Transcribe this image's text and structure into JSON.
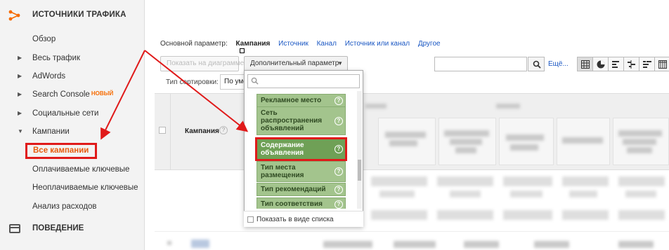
{
  "sidebar": {
    "title": "ИСТОЧНИКИ ТРАФИКА",
    "items": [
      {
        "label": "Обзор",
        "arrow": ""
      },
      {
        "label": "Весь трафик",
        "arrow": "▶"
      },
      {
        "label": "AdWords",
        "arrow": "▶"
      },
      {
        "label": "Search Console",
        "arrow": "▶",
        "badge": "НОВЫЙ"
      },
      {
        "label": "Социальные сети",
        "arrow": "▶"
      },
      {
        "label": "Кампании",
        "arrow": "▼"
      },
      {
        "label": "Все кампании",
        "arrow": "",
        "active": true
      },
      {
        "label": "Оплачиваемые ключевые",
        "arrow": ""
      },
      {
        "label": "Неоплачиваемые ключевые",
        "arrow": ""
      },
      {
        "label": "Анализ расходов",
        "arrow": ""
      }
    ],
    "behavior_label": "ПОВЕДЕНИЕ"
  },
  "primary": {
    "label": "Основной параметр:",
    "active": "Кампания",
    "links": [
      "Источник",
      "Канал",
      "Источник или канал",
      "Другое"
    ]
  },
  "toolbar": {
    "chart_button": "Показать на диаграмме",
    "secondary_button": "Дополнительный параметр",
    "sort_label": "Тип сортировки:",
    "sort_value": "По умолчанию",
    "search_value": "",
    "more_link": "Ещё...",
    "view_icons": [
      "table-view-icon",
      "pie-view-icon",
      "performance-view-icon",
      "comparison-view-icon",
      "term-cloud-view-icon",
      "pivot-view-icon"
    ]
  },
  "table": {
    "campaign_header": "Кампания",
    "help_glyph": "?"
  },
  "dropdown": {
    "search_placeholder": "",
    "options": [
      {
        "label": "Рекламное место"
      },
      {
        "label": "Сеть распространения объявлений"
      },
      {
        "label": "Содержание объявления",
        "selected": true
      },
      {
        "label": "Тип места размещения"
      },
      {
        "label": "Тип рекомендаций"
      },
      {
        "label": "Тип соответствия"
      }
    ],
    "help_glyph": "?",
    "list_view_label": "Показать в виде списка"
  },
  "colors": {
    "accent_orange": "#e8590c",
    "annotation_red": "#e01a1a",
    "link_blue": "#1a57c3",
    "option_green": "#a3c48d",
    "option_selected_green": "#6fa056"
  }
}
